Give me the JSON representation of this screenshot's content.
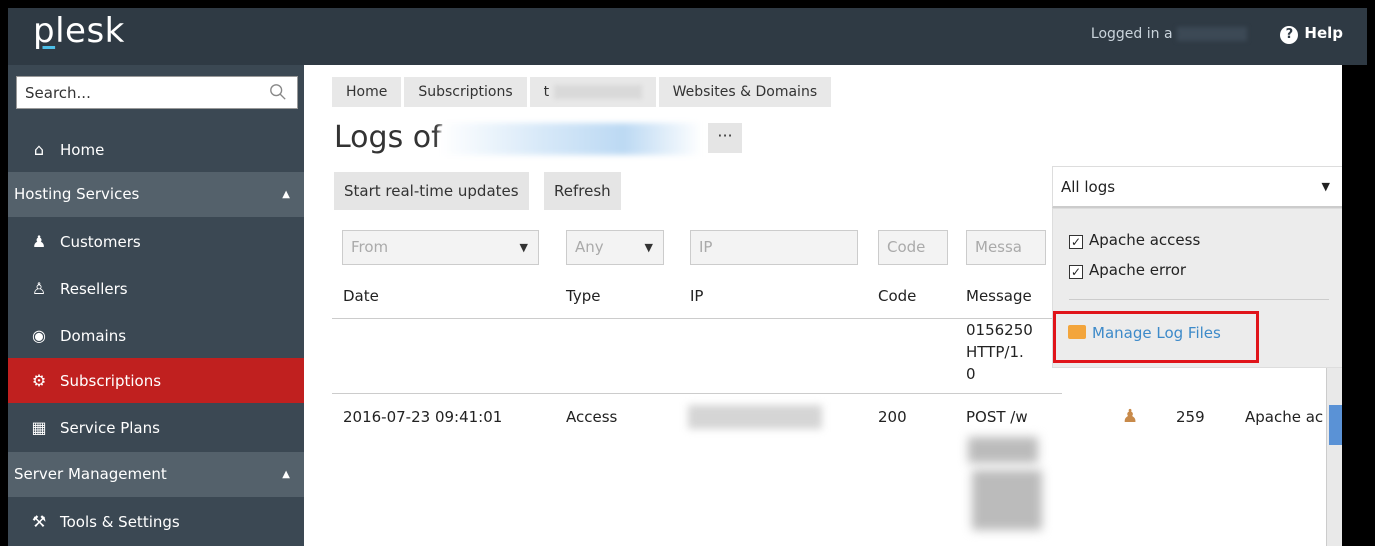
{
  "topbar": {
    "logo": "plesk",
    "logged_in": "Logged in a",
    "help": "Help"
  },
  "sidebar": {
    "search_placeholder": "Search...",
    "home": "Home",
    "sections": [
      {
        "label": "Hosting Services",
        "items": [
          "Customers",
          "Resellers",
          "Domains",
          "Subscriptions",
          "Service Plans"
        ]
      },
      {
        "label": "Server Management",
        "items": [
          "Tools & Settings"
        ]
      }
    ],
    "active_item": "Subscriptions",
    "icons": [
      "home-icon",
      "user-icon",
      "reseller-icon",
      "globe-icon",
      "gear-icon",
      "calendar-icon",
      "tools-icon"
    ]
  },
  "breadcrumb": [
    "Home",
    "Subscriptions",
    "t",
    "Websites & Domains"
  ],
  "page": {
    "title": "Logs of",
    "more": "···"
  },
  "toolbar": {
    "realtime": "Start real-time updates",
    "refresh": "Refresh"
  },
  "filters": {
    "from": "From",
    "type": "Any",
    "ip": "IP",
    "code": "Code",
    "message": "Messa"
  },
  "table": {
    "headers": [
      "Date",
      "Type",
      "IP",
      "Code",
      "Message"
    ],
    "partial_row": {
      "message_lines": [
        "0156250",
        "HTTP/1.",
        "0"
      ]
    },
    "rows": [
      {
        "date": "2016-07-23 09:41:01",
        "type": "Access",
        "code": "200",
        "message": "POST /w",
        "size": "259",
        "source": "Apache ac"
      }
    ]
  },
  "logs_dropdown": {
    "selected": "All logs",
    "options": [
      {
        "label": "Apache access",
        "checked": true
      },
      {
        "label": "Apache error",
        "checked": true
      }
    ],
    "manage": "Manage Log Files"
  },
  "colors": {
    "topbar": "#2f3a44",
    "sidebar": "#3b4853",
    "active": "#c0201f",
    "highlight": "#e0141a",
    "link": "#3d8ac9"
  }
}
